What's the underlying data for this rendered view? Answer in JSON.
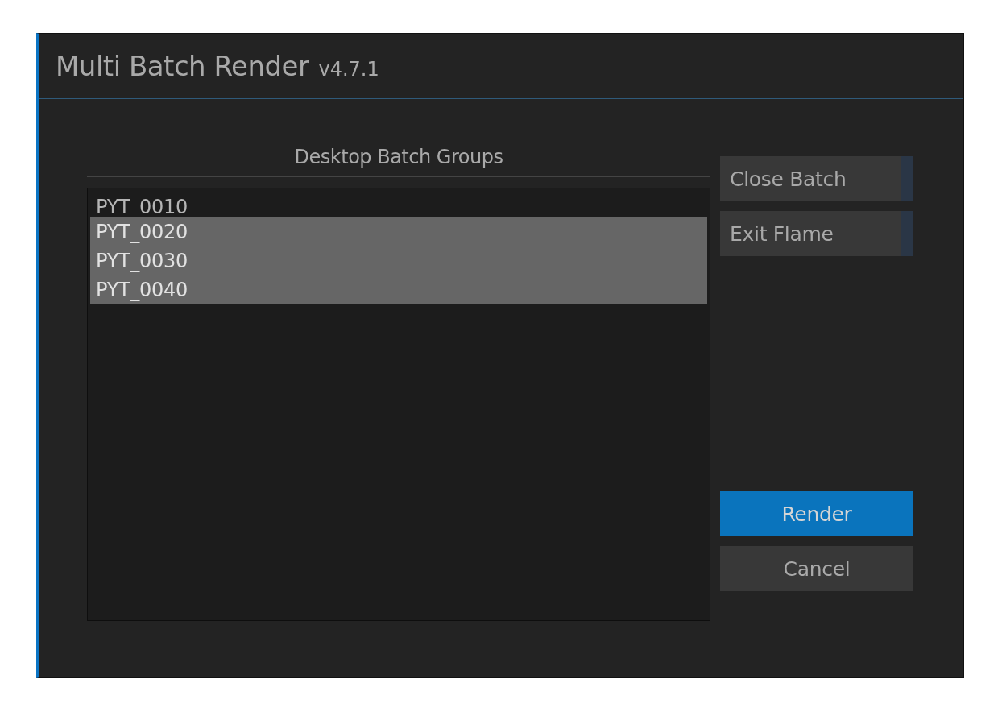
{
  "window": {
    "title": "Multi Batch Render",
    "version": "v4.7.1"
  },
  "list": {
    "heading": "Desktop Batch Groups",
    "items": [
      {
        "label": "PYT_0010",
        "selected": false
      },
      {
        "label": "PYT_0020",
        "selected": true
      },
      {
        "label": "PYT_0030",
        "selected": true
      },
      {
        "label": "PYT_0040",
        "selected": true
      }
    ]
  },
  "side_buttons": [
    {
      "label": "Close Batch",
      "kind": "option"
    },
    {
      "label": "Exit Flame",
      "kind": "option"
    }
  ],
  "action_buttons": [
    {
      "label": "Render",
      "kind": "primary"
    },
    {
      "label": "Cancel",
      "kind": "plain"
    }
  ]
}
